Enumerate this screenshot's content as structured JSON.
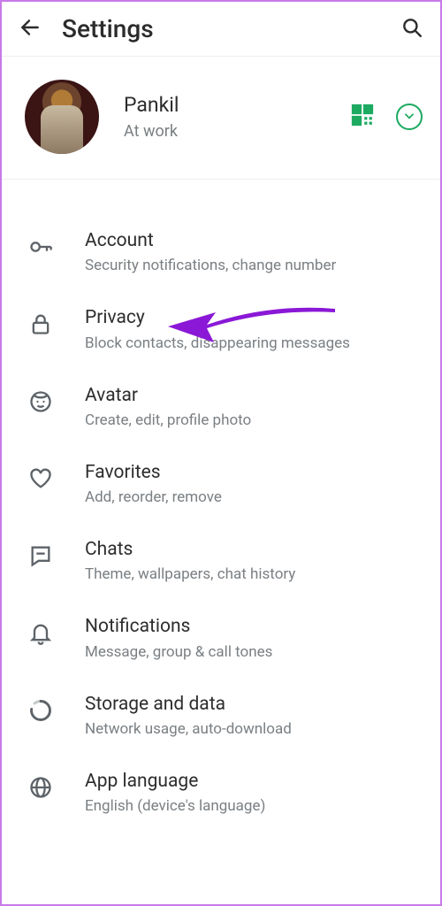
{
  "header": {
    "title": "Settings"
  },
  "profile": {
    "name": "Pankil",
    "status": "At work"
  },
  "items": [
    {
      "title": "Account",
      "subtitle": "Security notifications, change number"
    },
    {
      "title": "Privacy",
      "subtitle": "Block contacts, disappearing messages"
    },
    {
      "title": "Avatar",
      "subtitle": "Create, edit, profile photo"
    },
    {
      "title": "Favorites",
      "subtitle": "Add, reorder, remove"
    },
    {
      "title": "Chats",
      "subtitle": "Theme, wallpapers, chat history"
    },
    {
      "title": "Notifications",
      "subtitle": "Message, group & call tones"
    },
    {
      "title": "Storage and data",
      "subtitle": "Network usage, auto-download"
    },
    {
      "title": "App language",
      "subtitle": "English (device's language)"
    }
  ]
}
